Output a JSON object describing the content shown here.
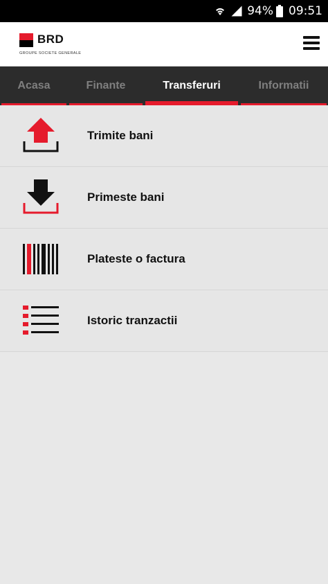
{
  "status_bar": {
    "battery": "94%",
    "time": "09:51"
  },
  "header": {
    "logo_name": "BRD",
    "logo_tagline": "GROUPE SOCIETE GENERALE"
  },
  "tabs": [
    {
      "label": "Acasa",
      "active": false
    },
    {
      "label": "Finante",
      "active": false
    },
    {
      "label": "Transferuri",
      "active": true
    },
    {
      "label": "Informatii",
      "active": false
    }
  ],
  "items": [
    {
      "label": "Trimite bani",
      "icon": "upload-icon"
    },
    {
      "label": "Primeste bani",
      "icon": "download-icon"
    },
    {
      "label": "Plateste o factura",
      "icon": "barcode-icon"
    },
    {
      "label": "Istoric tranzactii",
      "icon": "list-icon"
    }
  ],
  "colors": {
    "brand_red": "#e51b2c",
    "tab_bar": "#2c2c2c",
    "list_bg": "#e6e6e6"
  }
}
